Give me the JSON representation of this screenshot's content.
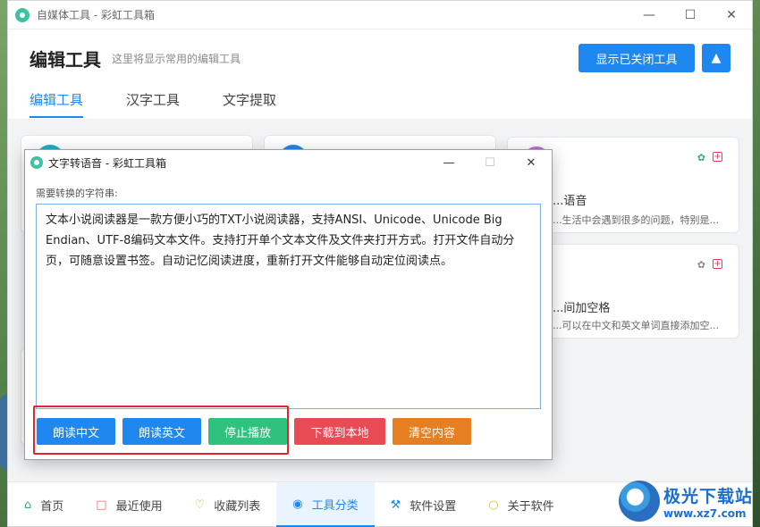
{
  "app": {
    "title": "自媒体工具 - 彩虹工具箱",
    "header_title": "编辑工具",
    "header_subtitle": "这里将显示常用的编辑工具",
    "show_closed_button": "显示已关闭工具",
    "tabs": [
      "编辑工具",
      "汉字工具",
      "文字提取"
    ]
  },
  "cards": [
    {
      "title": "...语音",
      "desc": "...生活中会遇到很多的问题，特别是..."
    },
    {
      "title": "...间加空格",
      "desc": "...可以在中文和英文单词直接添加空..."
    }
  ],
  "bottom_nav": [
    "首页",
    "最近使用",
    "收藏列表",
    "工具分类",
    "软件设置",
    "关于软件"
  ],
  "dialog": {
    "title": "文字转语音 - 彩虹工具箱",
    "label": "需要转换的字符串:",
    "text": "文本小说阅读器是一款方便小巧的TXT小说阅读器，支持ANSI、Unicode、Unicode Big Endian、UTF-8编码文本文件。支持打开单个文本文件及文件夹打开方式。打开文件自动分页，可随意设置书签。自动记忆阅读进度，重新打开文件能够自动定位阅读点。",
    "buttons": [
      "朗读中文",
      "朗读英文",
      "停止播放",
      "下载到本地",
      "清空内容"
    ]
  },
  "watermark": {
    "title": "极光下载站",
    "url": "www.xz7.com"
  },
  "colors": {
    "accent": "#1e88f0",
    "green": "#2ec27e",
    "red": "#e84b54",
    "orange": "#e67e22",
    "highlight": "#e0262c"
  }
}
